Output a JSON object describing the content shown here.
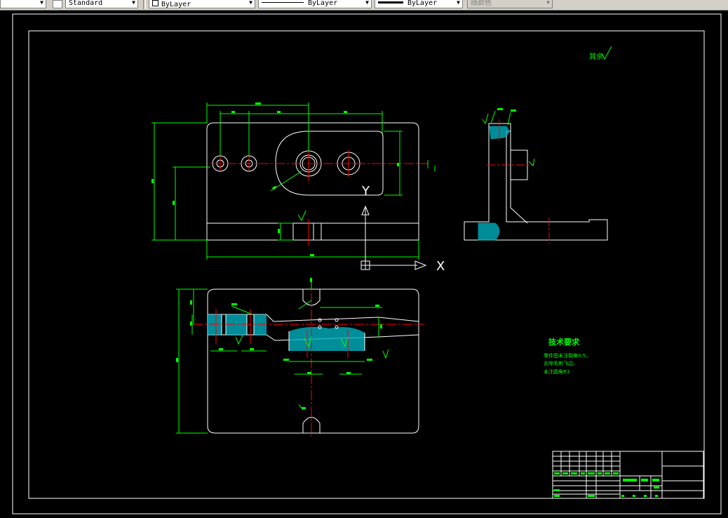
{
  "toolbar": {
    "style_value": "Standard",
    "layer_value": "ByLayer",
    "linetype_value": "ByLayer",
    "lineweight_value": "ByLayer",
    "color_value": "随颜色"
  },
  "drawing": {
    "surface_note": "其余",
    "axis_y": "Y",
    "axis_x": "X",
    "tech_req_title": "技术要求",
    "tech_req_items": [
      "零件图未注倒角0.5。",
      "去除毛刺飞边。",
      "未注圆角R3"
    ]
  },
  "colors": {
    "background": "#000000",
    "geometry": "#ffffff",
    "dimension": "#00ff00",
    "centerline": "#ff0000",
    "hatch": "#00b0c0"
  }
}
